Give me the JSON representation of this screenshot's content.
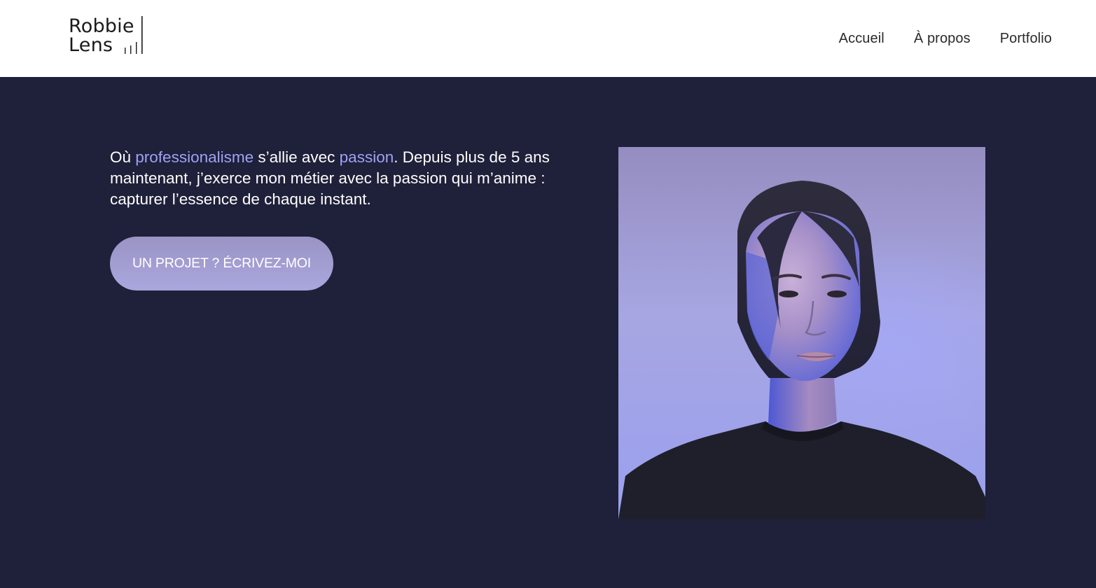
{
  "header": {
    "logo": {
      "line1": "Robbie",
      "line2": "Lens"
    },
    "nav": [
      {
        "label": "Accueil"
      },
      {
        "label": "À propos"
      },
      {
        "label": "Portfolio"
      }
    ]
  },
  "hero": {
    "intro": {
      "part1": "Où ",
      "highlight1": "professionalisme",
      "part2": " s’allie avec ",
      "highlight2": "passion",
      "part3": ". Depuis plus de 5 ans maintenant, j’exerce mon métier avec la passion qui m’anime : capturer l’essence de chaque instant."
    },
    "cta_label": "UN PROJET ? ÉCRIVEZ-MOI"
  },
  "colors": {
    "header_bg": "#ffffff",
    "page_bg": "#1f2039",
    "accent": "#9ea2f5",
    "button_bg": "#a39fd6"
  }
}
